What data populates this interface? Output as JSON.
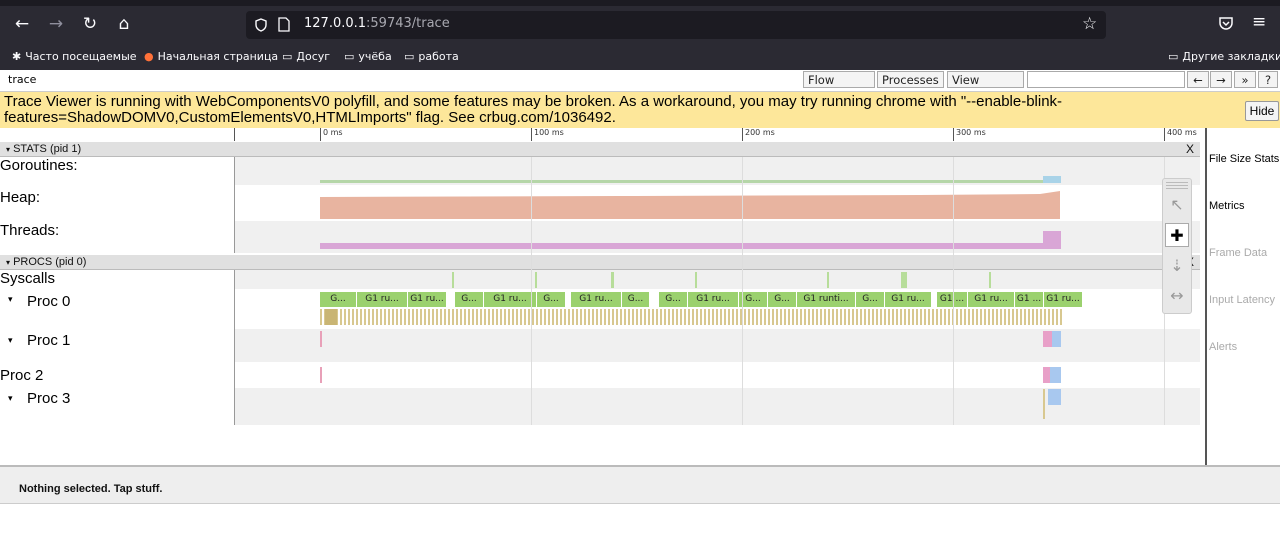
{
  "browser": {
    "url_host": "127.0.0.1",
    "url_port_path": ":59743/trace",
    "bookmarks": [
      {
        "label": "Часто посещаемые",
        "icon": "gear-icon"
      },
      {
        "label": "Начальная страница",
        "icon": "firefox-icon"
      },
      {
        "label": "Досуг",
        "icon": "folder-icon"
      },
      {
        "label": "учёба",
        "icon": "folder-icon"
      },
      {
        "label": "работа",
        "icon": "folder-icon"
      }
    ],
    "other_bookmarks": "Другие закладки"
  },
  "toolbar": {
    "title": "trace",
    "flow_events": "Flow events",
    "processes": "Processes",
    "view_options": "View Options",
    "nav_prev": "←",
    "nav_next": "→",
    "nav_more": "»",
    "help": "?"
  },
  "warning": {
    "message": "Trace Viewer is running with WebComponentsV0 polyfill, and some features may be broken. As a workaround, you may try running chrome with \"--enable-blink-features=ShadowDOMV0,CustomElementsV0,HTMLImports\" flag. See crbug.com/1036492.",
    "hide": "Hide"
  },
  "ruler": [
    "0 ms",
    "100 ms",
    "200 ms",
    "300 ms",
    "400 ms"
  ],
  "stats_header": "STATS (pid 1)",
  "procs_header": "PROCS (pid 0)",
  "close": "X",
  "stats_rows": [
    "Goroutines:",
    "Heap:",
    "Threads:"
  ],
  "proc_rows": {
    "syscalls": "Syscalls",
    "proc0": "Proc 0",
    "proc1": "Proc 1",
    "proc2": "Proc 2",
    "proc3": "Proc 3"
  },
  "expand_glyph": "▾",
  "proc0_slices": [
    "G...",
    "G1 ru...",
    "G1 ru...",
    "G...",
    "G1 ru...",
    "G...",
    "G1 ru...",
    "G...",
    "G...",
    "G1 ru...",
    "G...",
    "G...",
    "G1 runti...",
    "G...",
    "G1 ru...",
    "G1 ...",
    "G1 ru...",
    "G1 ...",
    "G1 ru..."
  ],
  "right_panel": [
    "File Size Stats",
    "Metrics",
    "Frame Data",
    "Input Latency",
    "Alerts"
  ],
  "status": "Nothing selected. Tap stuff.",
  "colors": {
    "slice": "#9bd16e",
    "heap": "#e8b4a0",
    "threads": "#d9a6d6",
    "warning": "#fde79a"
  }
}
